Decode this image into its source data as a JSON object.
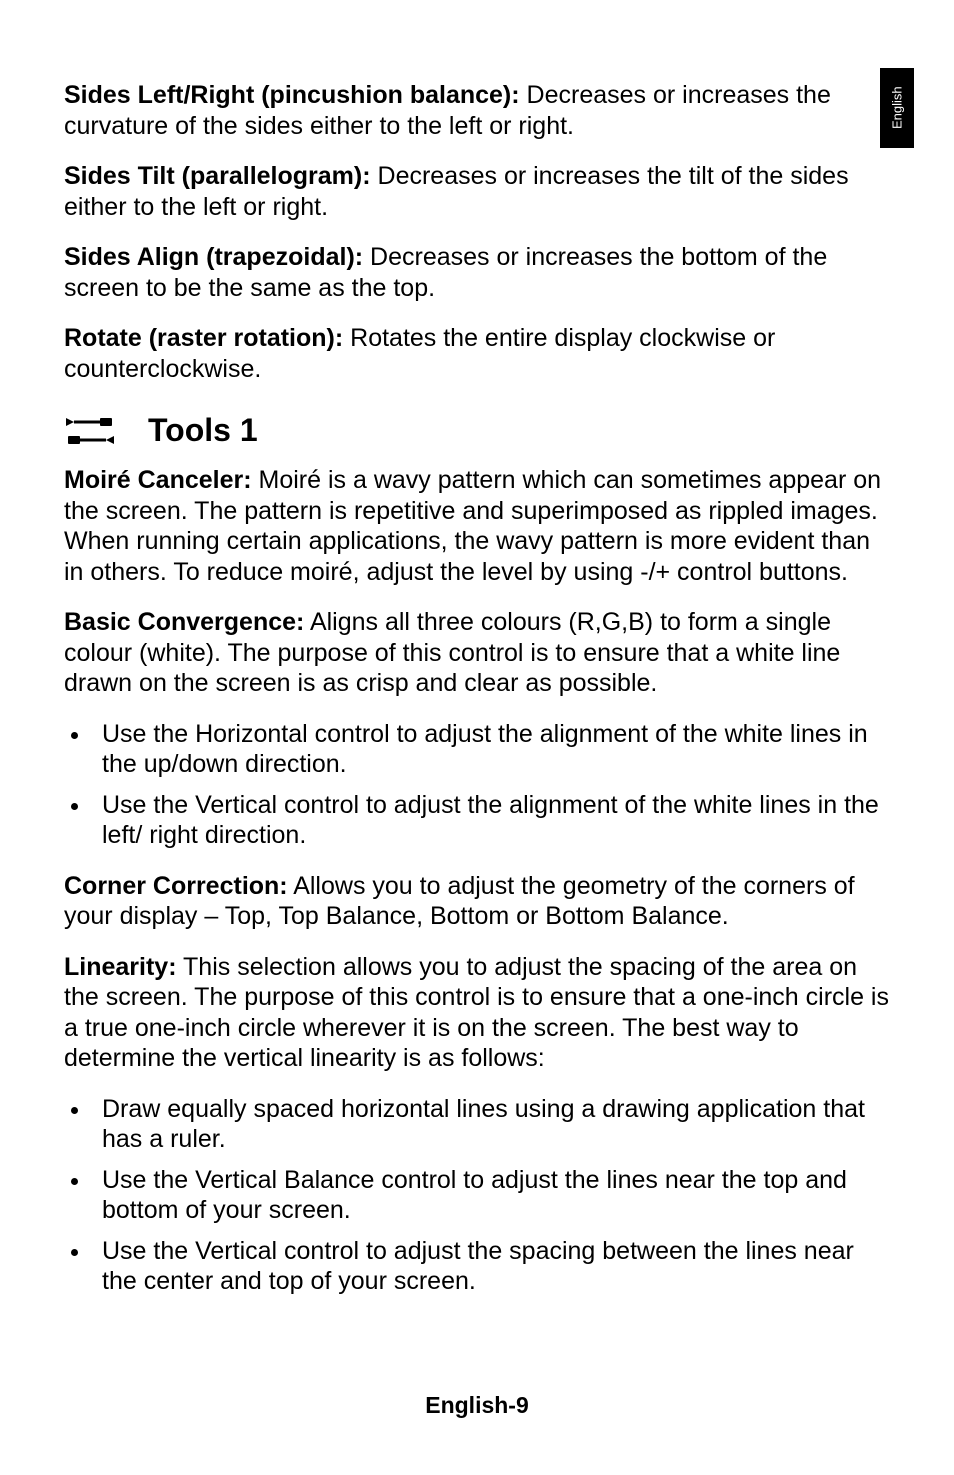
{
  "sideTab": "English",
  "paragraphs": {
    "p1": {
      "label": "Sides Left/Right (pincushion balance):",
      "text": " Decreases or increases the curvature of the sides either to the left or right."
    },
    "p2": {
      "label": "Sides Tilt (parallelogram):",
      "text": " Decreases or increases the tilt of the sides either to the left or right."
    },
    "p3": {
      "label": "Sides Align (trapezoidal):",
      "text": " Decreases or increases the bottom of the screen to be the same as the top."
    },
    "p4": {
      "label": "Rotate (raster rotation):",
      "text": " Rotates the entire display clockwise or counterclockwise."
    }
  },
  "section": {
    "iconName": "tools-icon",
    "title": "Tools 1"
  },
  "tools": {
    "moire": {
      "label": "Moiré Canceler:",
      "text": " Moiré is a wavy pattern which can sometimes appear on the screen. The pattern is repetitive and superimposed as rippled images. When running certain applications, the wavy pattern is more evident than in others. To reduce moiré, adjust the level by using -/+ control buttons."
    },
    "convergence": {
      "label": "Basic Convergence:",
      "text": " Aligns all three colours (R,G,B) to form a single colour (white). The purpose of this control is to ensure that a white line drawn on the screen is as crisp and clear as possible."
    },
    "convBullets": [
      "Use the Horizontal control to adjust the alignment of the white lines in the up/down direction.",
      "Use the Vertical control to adjust the alignment of the white lines in the left/ right direction."
    ],
    "corner": {
      "label": "Corner Correction:",
      "text": " Allows you to adjust the geometry of the corners of your display – Top, Top Balance, Bottom or Bottom Balance."
    },
    "linearity": {
      "label": "Linearity:",
      "text": " This selection allows you to adjust the spacing of the area on the screen. The purpose of this control is to ensure that a one-inch circle is a true one-inch circle wherever it is on the screen. The best way to determine the vertical linearity is as follows:"
    },
    "linBullets": [
      "Draw equally spaced horizontal lines using a drawing application that has a ruler.",
      "Use the Vertical Balance control to adjust the lines near the top and bottom of your screen.",
      "Use the Vertical control to adjust the spacing between the lines near the center and top of your screen."
    ]
  },
  "footer": "English-9"
}
